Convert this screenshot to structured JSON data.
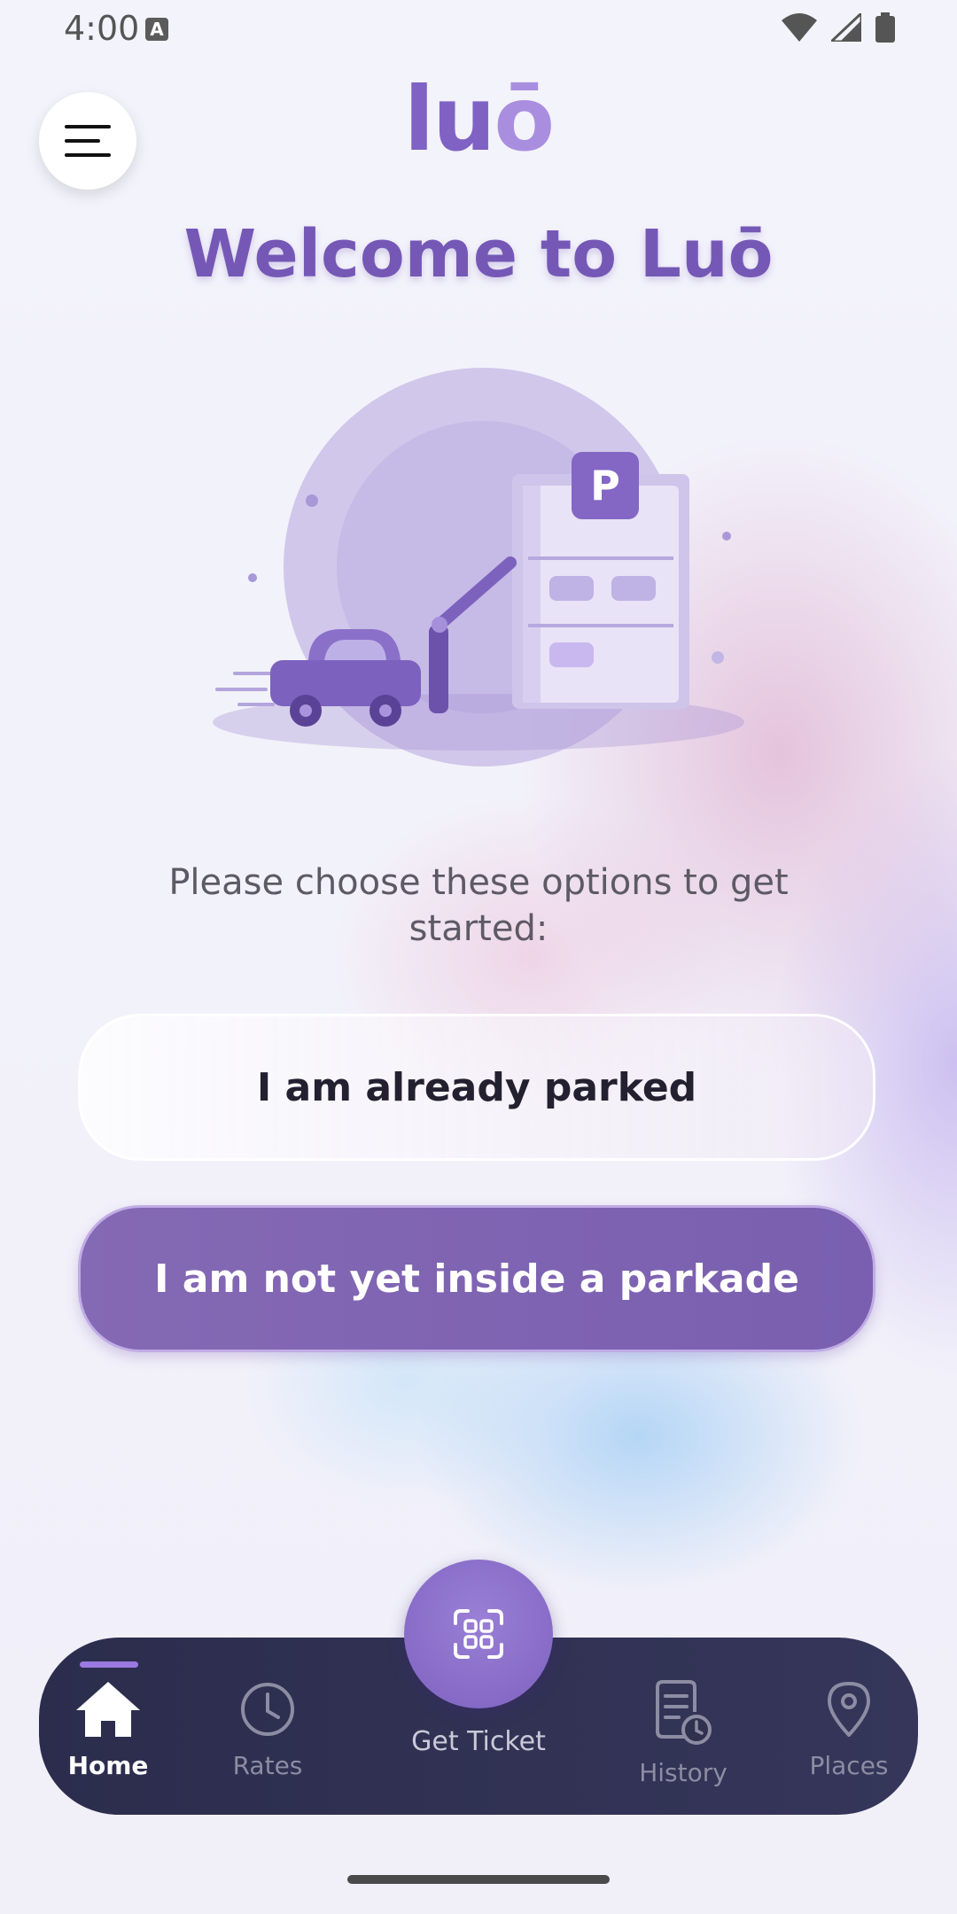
{
  "status_bar": {
    "time": "4:00",
    "notification_icon": "A"
  },
  "header": {
    "logo_main": "lu",
    "logo_accent": "ō",
    "menu_icon": "hamburger-menu-icon"
  },
  "main": {
    "title": "Welcome to Luō",
    "parking_sign_letter": "P",
    "subtitle": "Please choose these options to get started:",
    "options": [
      {
        "label": "I am already parked"
      },
      {
        "label": "I am not yet inside a parkade"
      }
    ]
  },
  "bottom_nav": {
    "items": [
      {
        "label": "Home",
        "icon": "home-icon",
        "active": true
      },
      {
        "label": "Rates",
        "icon": "clock-icon",
        "active": false
      },
      {
        "label": "Get Ticket",
        "icon": "ticket-scan-icon",
        "active": false
      },
      {
        "label": "History",
        "icon": "history-document-icon",
        "active": false
      },
      {
        "label": "Places",
        "icon": "location-pin-icon",
        "active": false
      }
    ]
  },
  "colors": {
    "accent": "#7f62c4",
    "nav_bg": "#2c2d4d",
    "primary_button": "#7a5fb0"
  }
}
